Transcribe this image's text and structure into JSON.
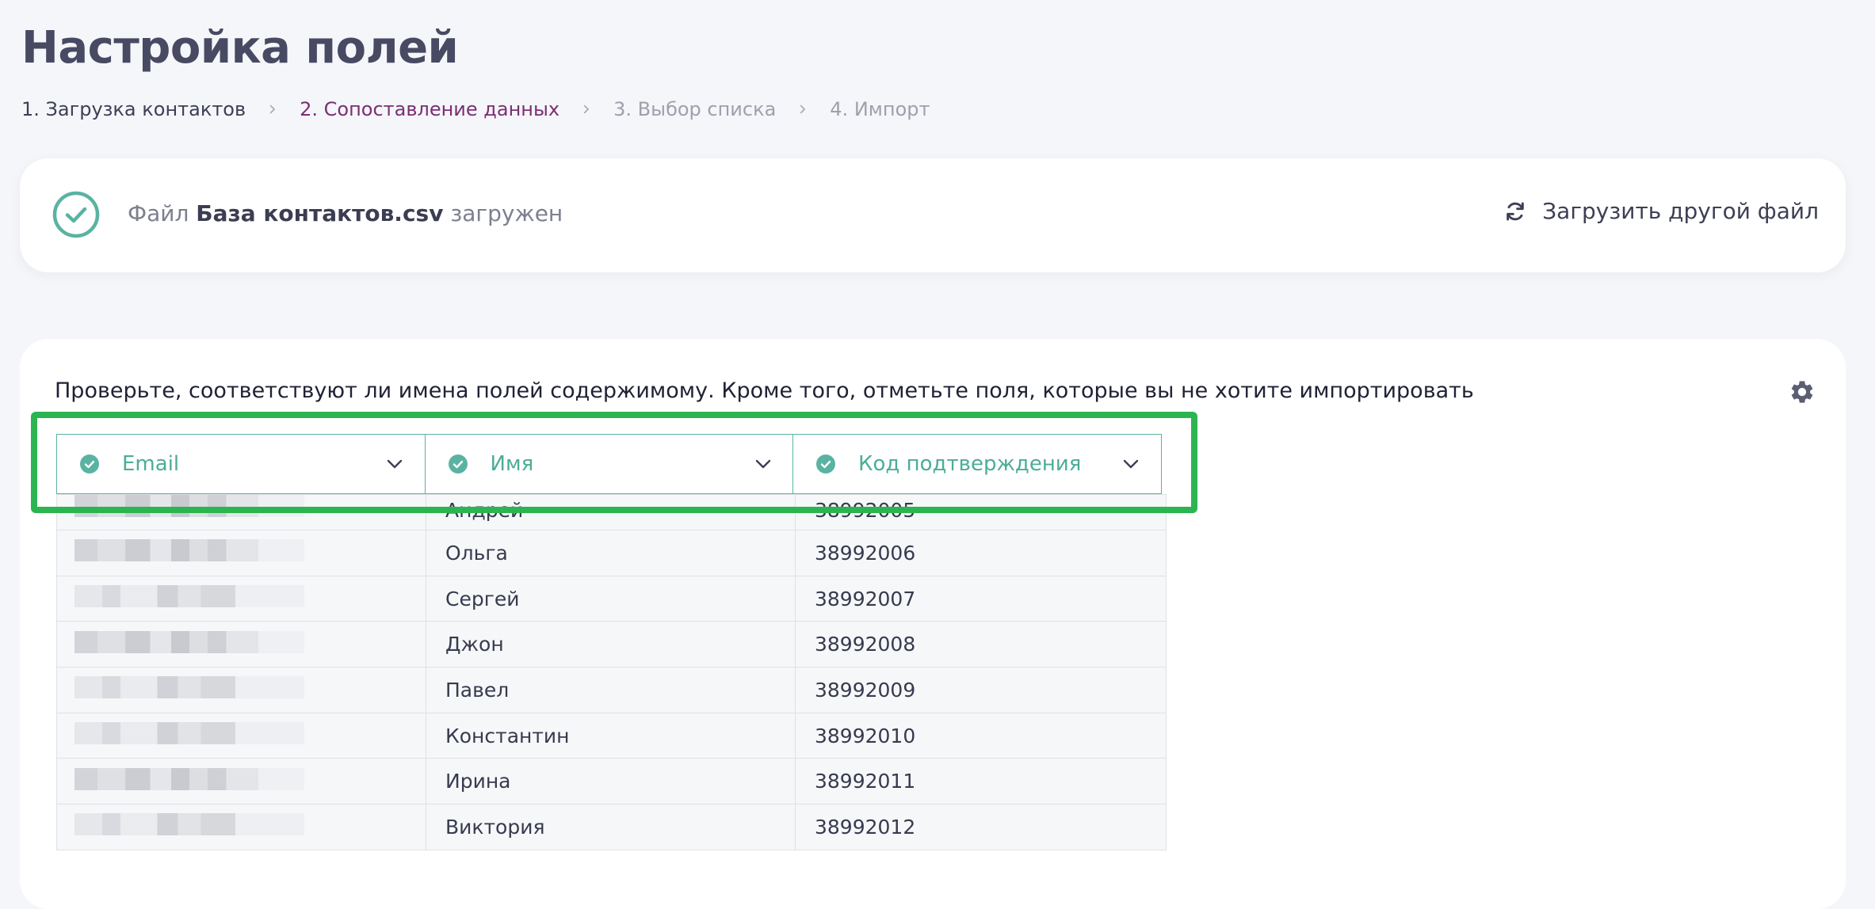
{
  "page": {
    "title": "Настройка полей"
  },
  "steps": [
    {
      "label": "1. Загрузка контактов",
      "state": "done"
    },
    {
      "label": "2. Сопоставление данных",
      "state": "active"
    },
    {
      "label": "3. Выбор списка",
      "state": "future"
    },
    {
      "label": "4. Импорт",
      "state": "future"
    }
  ],
  "file_status": {
    "prefix": "Файл",
    "file_name": "База контактов.csv",
    "suffix": "загружен",
    "reload_label": "Загрузить другой файл"
  },
  "mapping": {
    "hint": "Проверьте, соответствуют ли имена полей содержимому. Кроме того, отметьте поля, которые вы не хотите импортировать",
    "columns": [
      {
        "label": "Email"
      },
      {
        "label": "Имя"
      },
      {
        "label": "Код подтверждения"
      }
    ],
    "rows": [
      {
        "name": "Андрей",
        "code": "38992005"
      },
      {
        "name": "Ольга",
        "code": "38992006"
      },
      {
        "name": "Сергей",
        "code": "38992007"
      },
      {
        "name": "Джон",
        "code": "38992008"
      },
      {
        "name": "Павел",
        "code": "38992009"
      },
      {
        "name": "Константин",
        "code": "38992010"
      },
      {
        "name": "Ирина",
        "code": "38992011"
      },
      {
        "name": "Виктория",
        "code": "38992012"
      }
    ]
  },
  "colors": {
    "accent_green": "#4bad98",
    "active_step": "#7b2f73",
    "highlight": "#2bb551"
  }
}
